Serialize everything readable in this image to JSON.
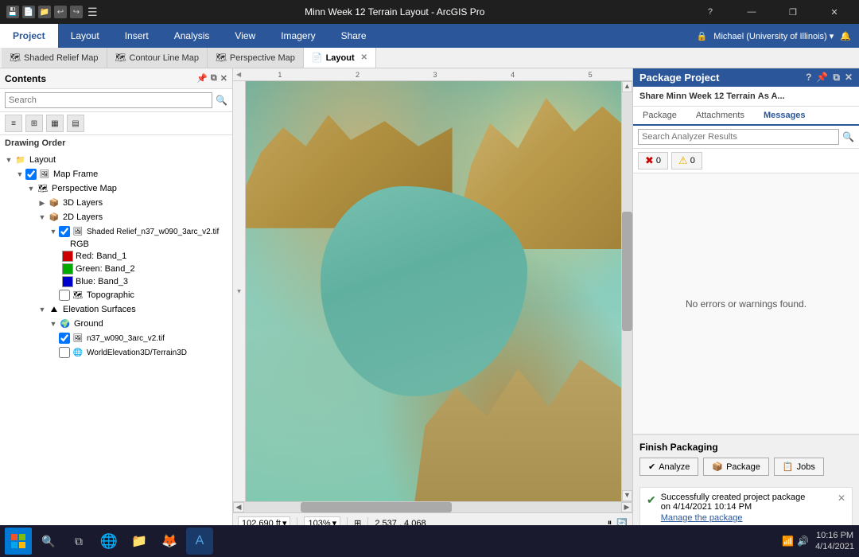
{
  "titlebar": {
    "title": "Minn Week 12 Terrain Layout - ArcGIS Pro",
    "help": "?",
    "minimize": "—",
    "restore": "❐",
    "close": "✕"
  },
  "ribbon": {
    "tabs": [
      "Project",
      "Layout",
      "Insert",
      "Analysis",
      "View",
      "Imagery",
      "Share"
    ],
    "active_tab": "Project",
    "user": "Michael (University of Illinois) ▾"
  },
  "map_tabs": [
    {
      "label": "Relief Map",
      "icon": "🗺",
      "active": false,
      "prefix": "Shaded"
    },
    {
      "label": "Contour Line Map",
      "icon": "🗺",
      "active": false
    },
    {
      "label": "Perspective Map",
      "icon": "🗺",
      "active": false
    },
    {
      "label": "Layout",
      "icon": "📄",
      "active": true,
      "closeable": true
    }
  ],
  "contents": {
    "title": "Contents",
    "search_placeholder": "Search",
    "drawing_order": "Drawing Order",
    "tree": [
      {
        "level": 0,
        "label": "Layout",
        "type": "folder",
        "expanded": true,
        "checked": true
      },
      {
        "level": 1,
        "label": "Map Frame",
        "type": "mapframe",
        "expanded": true,
        "checked": true
      },
      {
        "level": 2,
        "label": "Perspective Map",
        "type": "map",
        "expanded": true
      },
      {
        "level": 3,
        "label": "3D Layers",
        "type": "group",
        "expanded": false
      },
      {
        "level": 3,
        "label": "2D Layers",
        "type": "group",
        "expanded": true
      },
      {
        "level": 4,
        "label": "Shaded Relief_n37_w090_3arc_v2.tif",
        "type": "layer",
        "checked": true
      },
      {
        "level": 5,
        "label": "RGB",
        "type": "rgb"
      },
      {
        "level": 5,
        "label": "Red:  Band_1",
        "color": "#cc0000",
        "type": "band"
      },
      {
        "level": 5,
        "label": "Green: Band_2",
        "color": "#00aa00",
        "type": "band"
      },
      {
        "level": 5,
        "label": "Blue:  Band_3",
        "color": "#0000cc",
        "type": "band"
      },
      {
        "level": 4,
        "label": "Topographic",
        "type": "layer",
        "checked": false
      },
      {
        "level": 3,
        "label": "Elevation Surfaces",
        "type": "group",
        "expanded": true
      },
      {
        "level": 4,
        "label": "Ground",
        "type": "ground",
        "expanded": true
      },
      {
        "level": 5,
        "label": "n37_w090_3arc_v2.tif",
        "type": "raster",
        "checked": true
      },
      {
        "level": 5,
        "label": "WorldElevation3D/Terrain3D",
        "type": "raster",
        "checked": false
      }
    ]
  },
  "map_canvas": {
    "ruler_marks": [
      "1",
      "2",
      "3",
      "4",
      "5"
    ],
    "scale": "102,690 ft",
    "zoom": "103%",
    "coordinates": "2.537 , 4.068"
  },
  "right_panel": {
    "title": "Package Project",
    "close": "✕",
    "subtitle": "Share",
    "subtitle_bold": "Minn Week 12 Terrain",
    "subtitle_rest": "As A...",
    "tabs": [
      "Package",
      "Attachments",
      "Messages"
    ],
    "active_tab": "Messages",
    "search_placeholder": "Search Analyzer Results",
    "errors_count": "0",
    "warnings_count": "0",
    "no_errors_msg": "No errors or warnings found.",
    "finish_title": "Finish Packaging",
    "analyze_btn": "Analyze",
    "package_btn": "Package",
    "jobs_btn": "Jobs",
    "success_msg": "Successfully created project package",
    "success_date": "on 4/14/2021 10:14 PM",
    "success_link": "Manage the package"
  },
  "statusbar": {
    "scale": "102,690 ft",
    "zoom": "103%",
    "coords": "2.537 , 4.068"
  },
  "taskbar": {
    "time": "10:16 PM",
    "date": "4/14/2021"
  }
}
